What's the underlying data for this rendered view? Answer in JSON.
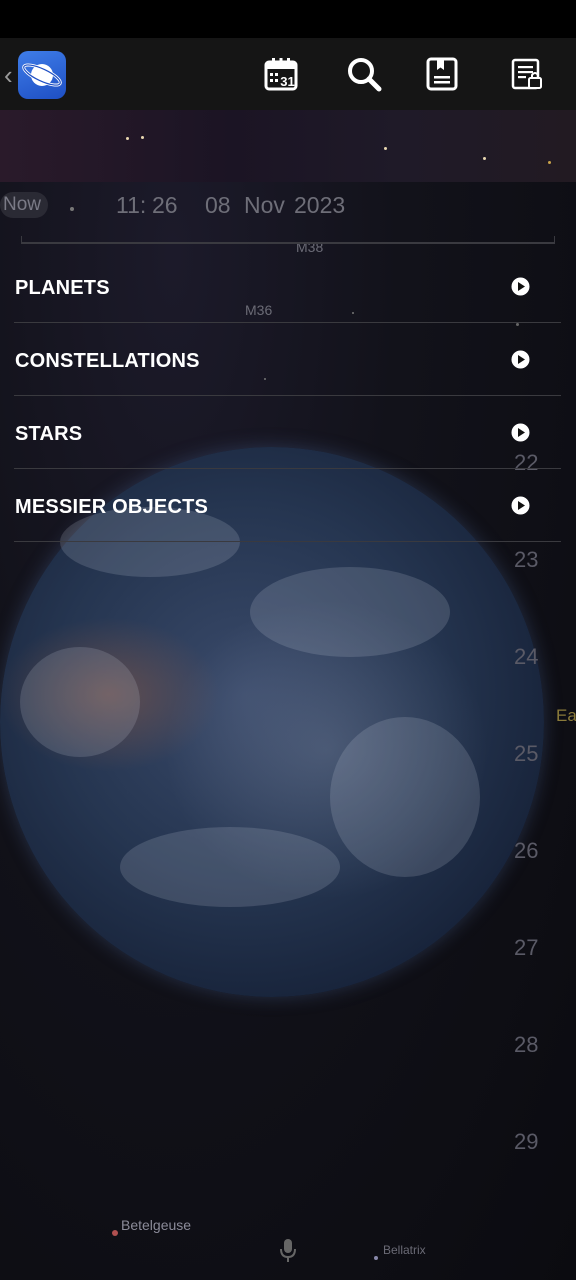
{
  "sky": {
    "labels": {
      "m38": "M38",
      "m36": "M36",
      "betelgeuse": "Betelgeuse",
      "bellatrix": "Bellatrix",
      "east_partial": "Ea"
    },
    "grid_numbers": [
      "22",
      "23",
      "24",
      "25",
      "26",
      "27",
      "28",
      "29"
    ]
  },
  "toolbar": {
    "back_icon": "chevron-left-icon",
    "calendar_icon": "calendar-icon",
    "calendar_day": "31",
    "search_icon": "search-icon",
    "bookmark_icon": "bookmark-icon",
    "notes_icon": "notes-lock-icon"
  },
  "time": {
    "now_label": "Now",
    "hour": "11:",
    "minute": "26",
    "day": "08",
    "month": "Nov",
    "year": "2023"
  },
  "menu": {
    "items": [
      {
        "label": "PLANETS"
      },
      {
        "label": "CONSTELLATIONS"
      },
      {
        "label": "STARS"
      },
      {
        "label": "MESSIER OBJECTS"
      }
    ]
  },
  "colors": {
    "accent_blue": "#2f63d6",
    "star_gold": "#e8d7b0",
    "label_gold": "#8a7a3a"
  }
}
